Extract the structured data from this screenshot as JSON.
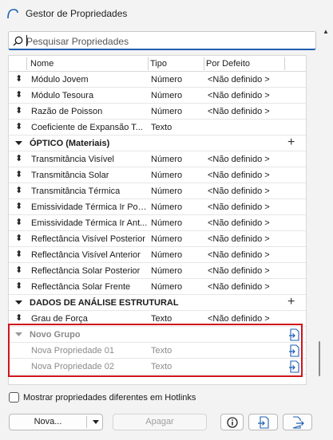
{
  "window": {
    "title": "Gestor de Propriedades"
  },
  "search": {
    "placeholder": "Pesquisar Propriedades"
  },
  "columns": {
    "nome": "Nome",
    "tipo": "Tipo",
    "defeito": "Por Defeito"
  },
  "rows": [
    {
      "name": "Módulo Jovem",
      "tipo": "Número",
      "def": "<Não definido >"
    },
    {
      "name": "Módulo Tesoura",
      "tipo": "Número",
      "def": "<Não definido >"
    },
    {
      "name": "Razão de Poisson",
      "tipo": "Número",
      "def": "<Não definido >"
    },
    {
      "name": "Coeficiente de Expansão T...",
      "tipo": "Texto",
      "def": ""
    }
  ],
  "group_optico": {
    "name": "ÓPTICO (Materiais)"
  },
  "rows_optico": [
    {
      "name": "Transmitância Visível",
      "tipo": "Número",
      "def": "<Não definido >"
    },
    {
      "name": "Transmitância Solar",
      "tipo": "Número",
      "def": "<Não definido >"
    },
    {
      "name": "Transmitância Térmica",
      "tipo": "Número",
      "def": "<Não definido >"
    },
    {
      "name": "Emissividade Térmica Ir Pos...",
      "tipo": "Número",
      "def": "<Não definido >"
    },
    {
      "name": "Emissividade Térmica Ir Ant...",
      "tipo": "Número",
      "def": "<Não definido >"
    },
    {
      "name": "Reflectância Visível Posterior",
      "tipo": "Número",
      "def": "<Não definido >"
    },
    {
      "name": "Reflectância Visível Anterior",
      "tipo": "Número",
      "def": "<Não definido >"
    },
    {
      "name": "Reflectância Solar Posterior",
      "tipo": "Número",
      "def": "<Não definido >"
    },
    {
      "name": "Reflectância Solar Frente",
      "tipo": "Número",
      "def": "<Não definido >"
    }
  ],
  "group_estrutural": {
    "name": "DADOS DE ANÁLISE ESTRUTURAL"
  },
  "rows_estrutural": [
    {
      "name": "Grau de Força",
      "tipo": "Texto",
      "def": "<Não definido >"
    }
  ],
  "group_novo": {
    "name": "Novo Grupo"
  },
  "rows_novo": [
    {
      "name": "Nova Propriedade 01",
      "tipo": "Texto"
    },
    {
      "name": "Nova Propriedade 02",
      "tipo": "Texto"
    }
  ],
  "footer": {
    "hotlinks_label": "Mostrar propriedades diferentes em Hotlinks",
    "nova_label": "Nova...",
    "apagar_label": "Apagar"
  },
  "colors": {
    "accent": "#1f5fb0",
    "highlight": "#d0151a",
    "disabled_text": "#9e9e9e"
  },
  "icons": [
    "app-arc-icon",
    "search-icon",
    "reorder-handle-icon",
    "collapse-caret-icon",
    "add-plus-icon",
    "new-property-icon",
    "info-icon",
    "import-icon",
    "export-icon",
    "chevron-down-icon"
  ]
}
